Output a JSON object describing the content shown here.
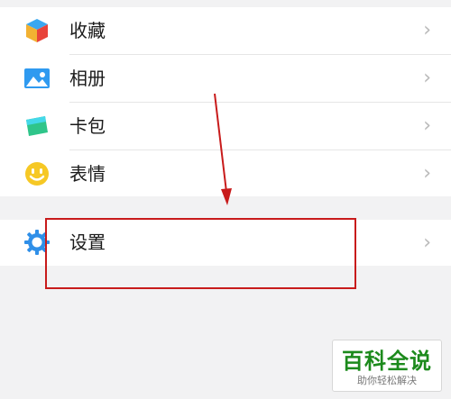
{
  "menu": {
    "items": [
      {
        "label": "收藏",
        "icon": "favorites-cube-icon"
      },
      {
        "label": "相册",
        "icon": "album-picture-icon"
      },
      {
        "label": "卡包",
        "icon": "card-wallet-icon"
      },
      {
        "label": "表情",
        "icon": "emoji-face-icon"
      }
    ],
    "settings": {
      "label": "设置",
      "icon": "settings-gear-icon"
    },
    "chevron": "›"
  },
  "colors": {
    "highlight_box": "#c81b1b",
    "annotation_arrow": "#c81b1b",
    "watermark_title": "#1c8a1c"
  },
  "watermark": {
    "title": "百科全说",
    "subtitle": "助你轻松解决"
  }
}
